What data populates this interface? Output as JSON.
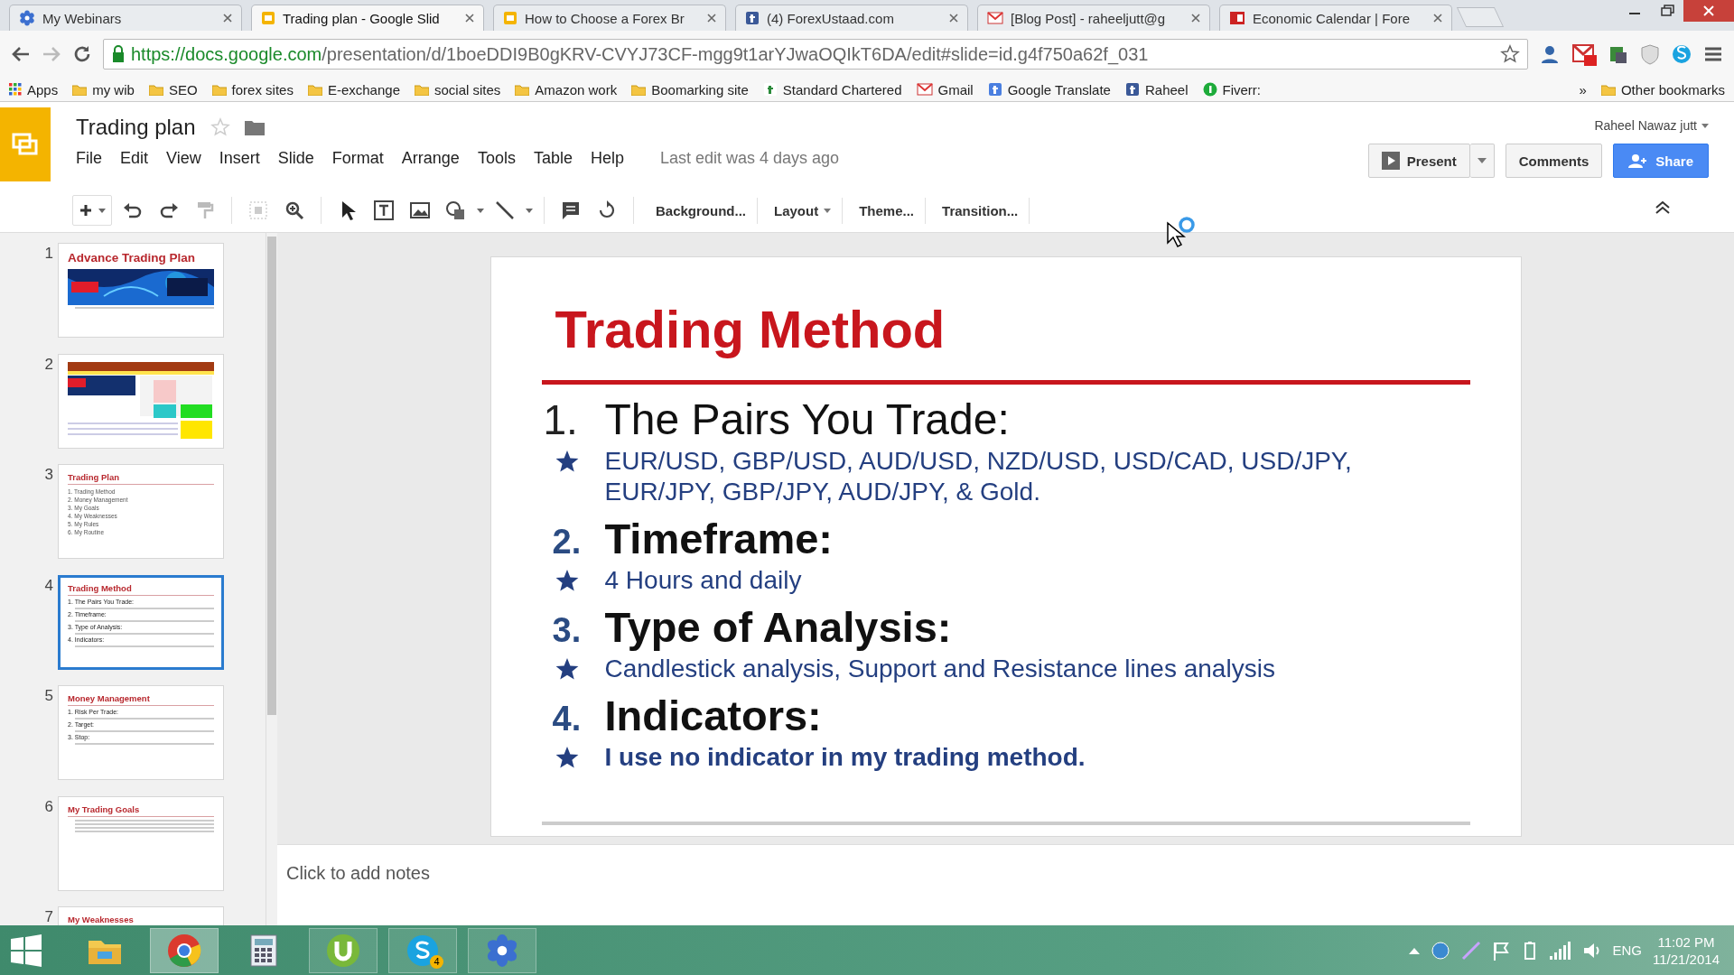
{
  "browser": {
    "tabs": [
      {
        "title": "My Webinars",
        "kind": "flower",
        "selected": false
      },
      {
        "title": "Trading plan - Google Slid",
        "kind": "slides",
        "selected": true
      },
      {
        "title": "How to Choose a Forex Br",
        "kind": "slides",
        "selected": false
      },
      {
        "title": "(4) ForexUstaad.com",
        "kind": "facebook",
        "selected": false
      },
      {
        "title": "[Blog Post] - raheeljutt@g",
        "kind": "gmail",
        "selected": false
      },
      {
        "title": "Economic Calendar | Fore",
        "kind": "calendar",
        "selected": false
      }
    ],
    "address": {
      "host": "https://docs.google.com",
      "path": "/presentation/d/1boeDDI9B0gKRV-CVYJ73CF-mgg9t1arYJwaOQIkT6DA/edit#slide=id.g4f750a62f_031"
    },
    "bookmarks": [
      {
        "label": "Apps",
        "kind": "apps"
      },
      {
        "label": "my wib",
        "kind": "folder"
      },
      {
        "label": "SEO",
        "kind": "folder"
      },
      {
        "label": "forex sites",
        "kind": "folder"
      },
      {
        "label": "E-exchange",
        "kind": "folder"
      },
      {
        "label": "social sites",
        "kind": "folder"
      },
      {
        "label": "Amazon work",
        "kind": "folder"
      },
      {
        "label": "Boomarking site",
        "kind": "folder"
      },
      {
        "label": "Standard Chartered",
        "kind": "site"
      },
      {
        "label": "Gmail",
        "kind": "gmail"
      },
      {
        "label": "Google Translate",
        "kind": "translate"
      },
      {
        "label": "Raheel",
        "kind": "facebook"
      },
      {
        "label": "Fiverr:",
        "kind": "fiverr"
      }
    ],
    "bookmarks_overflow": "»",
    "other_bookmarks": "Other bookmarks"
  },
  "app": {
    "title": "Trading plan",
    "menu": [
      "File",
      "Edit",
      "View",
      "Insert",
      "Slide",
      "Format",
      "Arrange",
      "Tools",
      "Table",
      "Help"
    ],
    "last_edit": "Last edit was 4 days ago",
    "user": "Raheel Nawaz jutt",
    "present": "Present",
    "comments": "Comments",
    "share": "Share"
  },
  "toolbar": {
    "buttons": [
      {
        "label": "Background...",
        "dropdown": false
      },
      {
        "label": "Layout",
        "dropdown": true
      },
      {
        "label": "Theme...",
        "dropdown": false
      },
      {
        "label": "Transition...",
        "dropdown": false
      }
    ]
  },
  "filmstrip": [
    {
      "number": "1",
      "kind": "cover",
      "title": "Advance Trading Plan",
      "selected": false
    },
    {
      "number": "2",
      "kind": "table",
      "selected": false
    },
    {
      "number": "3",
      "kind": "list",
      "title": "Trading Plan",
      "items": [
        "1.  Trading Method",
        "2.  Money Management",
        "3.  My Goals",
        "4.  My Weaknesses",
        "5.  My Rules",
        "6.  My Routine"
      ],
      "selected": false
    },
    {
      "number": "4",
      "kind": "outline",
      "title": "Trading Method",
      "items": [
        "1.  The Pairs You Trade:",
        "2.  Timeframe:",
        "3.  Type of Analysis:",
        "4.  Indicators:"
      ],
      "selected": true
    },
    {
      "number": "5",
      "kind": "outline",
      "title": "Money Management",
      "items": [
        "1.  Risk Per Trade:",
        "2.  Target:",
        "3.  Stop:"
      ],
      "selected": false
    },
    {
      "number": "6",
      "kind": "bullets",
      "title": "My Trading Goals",
      "selected": false
    },
    {
      "number": "7",
      "kind": "bullets",
      "title": "My Weaknesses",
      "selected": false
    }
  ],
  "slide": {
    "title": "Trading Method",
    "sections": [
      {
        "number": "1.",
        "heading": "The Pairs You Trade:",
        "bold": false,
        "text": "EUR/USD, GBP/USD, AUD/USD, NZD/USD, USD/CAD, USD/JPY, EUR/JPY, GBP/JPY, AUD/JPY, & Gold.",
        "text_bold": false
      },
      {
        "number": "2.",
        "heading": "Timeframe:",
        "bold": true,
        "text": "4 Hours and daily",
        "text_bold": false
      },
      {
        "number": "3.",
        "heading": "Type of Analysis:",
        "bold": true,
        "text": "Candlestick analysis, Support and Resistance lines analysis",
        "text_bold": false
      },
      {
        "number": "4.",
        "heading": "Indicators:",
        "bold": true,
        "text": "I use no indicator in my trading method.",
        "text_bold": true
      }
    ]
  },
  "notes": {
    "placeholder": "Click to add notes"
  },
  "taskbar": {
    "apps": [
      {
        "kind": "explorer",
        "running": false,
        "selected": false
      },
      {
        "kind": "chrome",
        "running": true,
        "selected": true
      },
      {
        "kind": "calculator",
        "running": false,
        "selected": false
      },
      {
        "kind": "torrent",
        "running": true,
        "selected": false
      },
      {
        "kind": "skype",
        "running": true,
        "selected": false,
        "badge": "4"
      },
      {
        "kind": "flower",
        "running": true,
        "selected": false
      }
    ],
    "language": "ENG",
    "time": "11:02 PM",
    "date": "11/21/2014"
  }
}
